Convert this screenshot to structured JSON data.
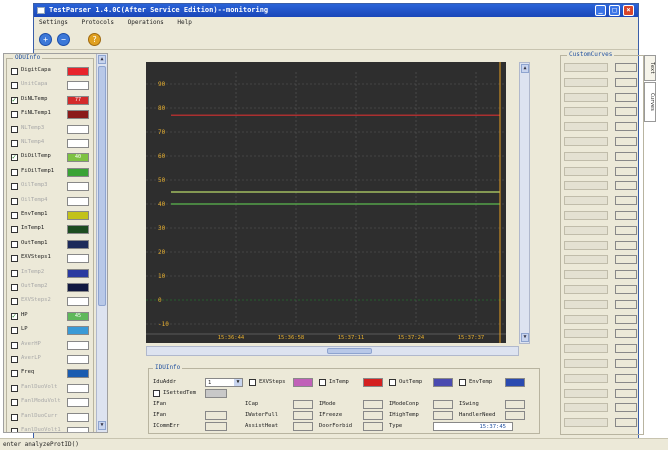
{
  "window": {
    "title": "TestParser 1.4.0C(After Service Edition)--monitoring"
  },
  "menu": {
    "items": [
      "Settings",
      "Protocols",
      "Operations",
      "Help"
    ]
  },
  "toolbar": {
    "tools": [
      "zoom-in-icon",
      "zoom-out-icon",
      "help-icon"
    ]
  },
  "odu_panel": {
    "title": "ODUInfo",
    "items": [
      {
        "label": "DigitCapa",
        "checked": false,
        "enabled": true,
        "color": "#e8232b",
        "value": ""
      },
      {
        "label": "UnitCapa",
        "checked": false,
        "enabled": false,
        "color": "#ffffff",
        "value": ""
      },
      {
        "label": "DiNLTemp",
        "checked": true,
        "enabled": true,
        "color": "#d42a2a",
        "value": "77"
      },
      {
        "label": "FiNLTemp1",
        "checked": false,
        "enabled": true,
        "color": "#8b1a1a",
        "value": ""
      },
      {
        "label": "NLTemp3",
        "checked": false,
        "enabled": false,
        "color": "#ffffff",
        "value": ""
      },
      {
        "label": "NLTemp4",
        "checked": false,
        "enabled": false,
        "color": "#ffffff",
        "value": ""
      },
      {
        "label": "DiOilTemp",
        "checked": true,
        "enabled": true,
        "color": "#7dc242",
        "value": "40"
      },
      {
        "label": "FiOilTemp1",
        "checked": false,
        "enabled": true,
        "color": "#3aa335",
        "value": ""
      },
      {
        "label": "OilTemp3",
        "checked": false,
        "enabled": false,
        "color": "#ffffff",
        "value": ""
      },
      {
        "label": "OilTemp4",
        "checked": false,
        "enabled": false,
        "color": "#ffffff",
        "value": ""
      },
      {
        "label": "EnvTemp1",
        "checked": false,
        "enabled": true,
        "color": "#c2c21a",
        "value": ""
      },
      {
        "label": "InTemp1",
        "checked": false,
        "enabled": true,
        "color": "#1c4c20",
        "value": ""
      },
      {
        "label": "OutTemp1",
        "checked": false,
        "enabled": true,
        "color": "#1c2a5a",
        "value": ""
      },
      {
        "label": "EXVSteps1",
        "checked": false,
        "enabled": true,
        "color": "#ffffff",
        "value": ""
      },
      {
        "label": "InTemp2",
        "checked": false,
        "enabled": false,
        "color": "#2a3aa0",
        "value": ""
      },
      {
        "label": "OutTemp2",
        "checked": false,
        "enabled": false,
        "color": "#101840",
        "value": ""
      },
      {
        "label": "EXVSteps2",
        "checked": false,
        "enabled": false,
        "color": "#ffffff",
        "value": ""
      },
      {
        "label": "HP",
        "checked": true,
        "enabled": true,
        "color": "#5fb85a",
        "value": "45"
      },
      {
        "label": "LP",
        "checked": false,
        "enabled": true,
        "color": "#3a9ad6",
        "value": ""
      },
      {
        "label": "AverHP",
        "checked": false,
        "enabled": false,
        "color": "#ffffff",
        "value": ""
      },
      {
        "label": "AverLP",
        "checked": false,
        "enabled": false,
        "color": "#ffffff",
        "value": ""
      },
      {
        "label": "Freq",
        "checked": false,
        "enabled": true,
        "color": "#1a5cb0",
        "value": ""
      },
      {
        "label": "FanlDuoVolt",
        "checked": false,
        "enabled": false,
        "color": "#ffffff",
        "value": ""
      },
      {
        "label": "FanlModuVolt",
        "checked": false,
        "enabled": false,
        "color": "#ffffff",
        "value": ""
      },
      {
        "label": "FanlDuoCurr",
        "checked": false,
        "enabled": false,
        "color": "#ffffff",
        "value": ""
      },
      {
        "label": "FanlDuoVolt1",
        "checked": false,
        "enabled": false,
        "color": "#ffffff",
        "value": ""
      }
    ]
  },
  "chart_data": {
    "type": "line",
    "ylim": [
      -10,
      95
    ],
    "yticks": [
      -10,
      0,
      10,
      20,
      30,
      40,
      50,
      60,
      70,
      80,
      90
    ],
    "xticks": [
      "15:36:44",
      "15:36:58",
      "15:37:11",
      "15:37:24",
      "15:37:37"
    ],
    "series": [
      {
        "color": "#d43030",
        "values": [
          77,
          77,
          77,
          77,
          77
        ]
      },
      {
        "color": "#b7d76a",
        "values": [
          45,
          45,
          45,
          45,
          45
        ]
      },
      {
        "color": "#5cb84e",
        "values": [
          40,
          40,
          40,
          40,
          40
        ]
      }
    ],
    "background": "#2e2e2e",
    "grid_color": "#1f8a2c",
    "cursor_color": "#e8a020"
  },
  "idu_panel": {
    "title": "IDUInfo",
    "idu_addr_label": "IduAddr",
    "idu_addr_value": "1",
    "checks": [
      {
        "label": "EXVSteps",
        "color": "#c060b8"
      },
      {
        "label": "InTemp",
        "color": "#d42020"
      },
      {
        "label": "OutTemp",
        "color": "#4a4ab0"
      },
      {
        "label": "EnvTemp",
        "color": "#2a4ab0"
      }
    ],
    "setted_temp_label": "ISettedTem",
    "fields_row3": [
      "IFan",
      "ICap",
      "IMode",
      "IModeConp",
      "ISwing"
    ],
    "fields_row4": [
      "IFan",
      "IWaterFull",
      "IFreeze",
      "IHighTemp",
      "HandlerNeed"
    ],
    "fields_row5": [
      "ICommErr",
      "AssistHeat",
      "DoorForbid",
      "Type"
    ],
    "time_value": "15:37:45"
  },
  "custom_curves": {
    "title": "CustomCurves"
  },
  "side_tabs": [
    "Text",
    "Curves"
  ],
  "status": {
    "text": "enter analyzeProtID()"
  }
}
